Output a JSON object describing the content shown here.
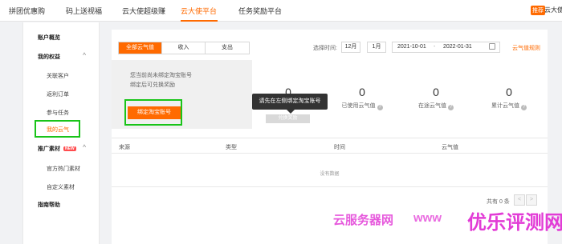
{
  "topnav": {
    "items": [
      "拼团优惠购",
      "码上送视福",
      "云大使超级赚",
      "云大使平台",
      "任务奖励平台"
    ],
    "active_index": 3,
    "badge": "推荐",
    "user_text": "云大使"
  },
  "sidebar": {
    "items": [
      {
        "label": "账户概览",
        "kind": "group"
      },
      {
        "label": "我的权益",
        "kind": "group",
        "chevron": "^"
      },
      {
        "label": "关联客户",
        "kind": "sub"
      },
      {
        "label": "返利订单",
        "kind": "sub"
      },
      {
        "label": "参与任务",
        "kind": "sub"
      },
      {
        "label": "我的云气",
        "kind": "sub",
        "active": true
      },
      {
        "label": "推广素材",
        "kind": "group",
        "chevron": "^",
        "badge": "NEW"
      },
      {
        "label": "官方热门素材",
        "kind": "sub"
      },
      {
        "label": "自定义素材",
        "kind": "sub"
      },
      {
        "label": "指南帮助",
        "kind": "group"
      }
    ]
  },
  "tabs": [
    "全部云气值",
    "收入",
    "支出"
  ],
  "active_tab": 0,
  "filter": {
    "label": "选择时间:",
    "month_buttons": [
      "12月",
      "1月"
    ],
    "date_start": "2021-10-01",
    "date_sep": "-",
    "date_end": "2022-01-31",
    "rule_link": "云气值规则"
  },
  "bind_notice": {
    "line1": "您当前尚未绑定淘宝账号",
    "line2": "绑定后可兑换奖励",
    "button": "绑定淘宝账号"
  },
  "stats": [
    {
      "value": "0",
      "label": ""
    },
    {
      "value": "0",
      "label": "已使用云气值"
    },
    {
      "value": "0",
      "label": "在途云气值"
    },
    {
      "value": "0",
      "label": "累计云气值"
    }
  ],
  "tooltip": "请先在左侧绑定淘宝账号",
  "disabled_button": "兑换奖励",
  "table": {
    "headers": [
      "来源",
      "类型",
      "时间",
      "云气值"
    ],
    "empty_text": "没有数据"
  },
  "pager": {
    "total": "共有 0 条",
    "prev": "<",
    "next": ">"
  },
  "watermark": {
    "a": "云服务器网",
    "b": "www",
    "c": "优乐评测网"
  },
  "colors": {
    "accent": "#ff6a00",
    "highlight_box": "#19c419",
    "watermark": "#e23cd6"
  },
  "icons": [
    "question-icon",
    "calendar-icon",
    "chevron-up-icon"
  ]
}
